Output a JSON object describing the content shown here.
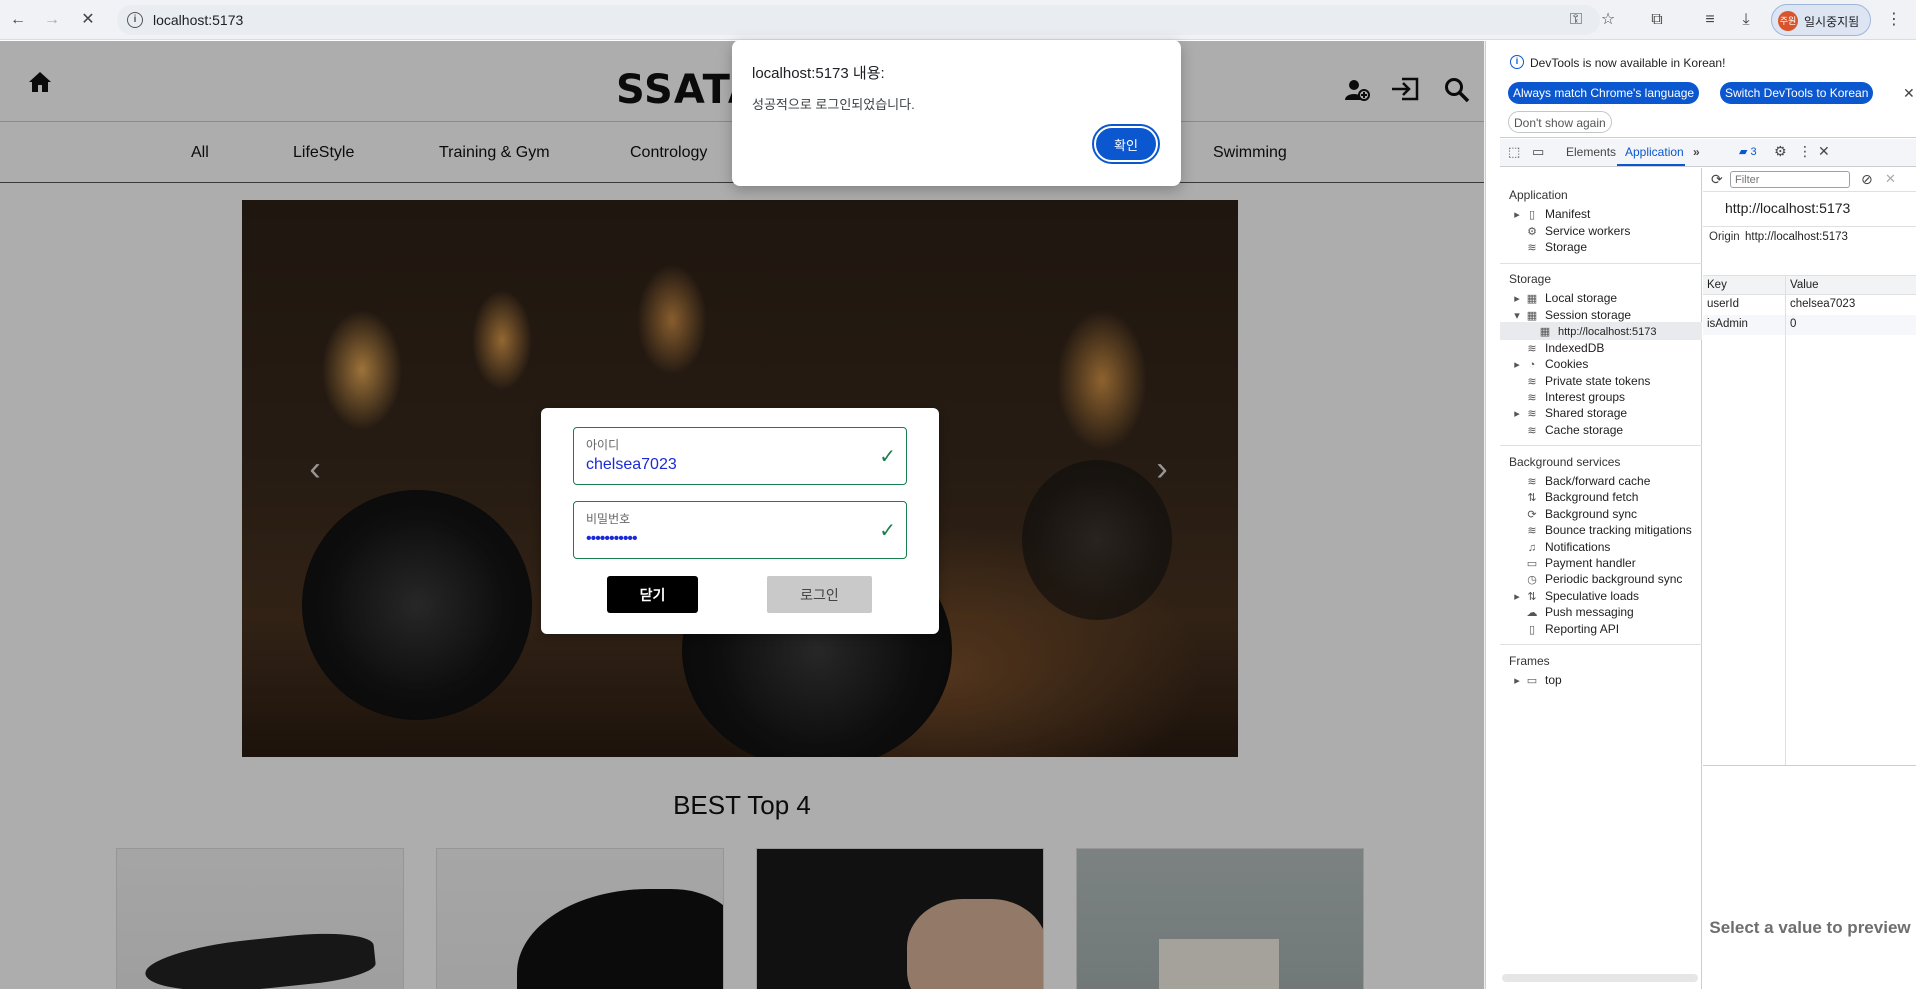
{
  "browser": {
    "url": "localhost:5173",
    "profile_label": "일시중지됨",
    "profile_avatar": "주원"
  },
  "site": {
    "logo": "SSATA",
    "categories": [
      "All",
      "LifeStyle",
      "Training & Gym",
      "Contrology",
      "Swimming"
    ],
    "best_title": "BEST Top 4",
    "carousel_prev": "‹",
    "carousel_next": "›"
  },
  "login_modal": {
    "id_label": "아이디",
    "id_value": "chelsea7023",
    "pw_label": "비밀번호",
    "pw_value": "•••••••••••",
    "close_label": "닫기",
    "login_label": "로그인"
  },
  "alert": {
    "title": "localhost:5173 내용:",
    "message": "성공적으로 로그인되었습니다.",
    "ok_label": "확인"
  },
  "devtools": {
    "banner": "DevTools is now available in Korean!",
    "btn_match": "Always match Chrome's language",
    "btn_switch": "Switch DevTools to Korean",
    "btn_dont_show": "Don't show again",
    "tabs": [
      "Elements",
      "Application"
    ],
    "issues_count": "3",
    "sidebar": {
      "application_heading": "Application",
      "application_items": [
        "Manifest",
        "Service workers",
        "Storage"
      ],
      "storage_heading": "Storage",
      "storage_items": [
        "Local storage",
        "Session storage",
        "http://localhost:5173",
        "IndexedDB",
        "Cookies",
        "Private state tokens",
        "Interest groups",
        "Shared storage",
        "Cache storage"
      ],
      "background_heading": "Background services",
      "background_items": [
        "Back/forward cache",
        "Background fetch",
        "Background sync",
        "Bounce tracking mitigations",
        "Notifications",
        "Payment handler",
        "Periodic background sync",
        "Speculative loads",
        "Push messaging",
        "Reporting API"
      ],
      "frames_heading": "Frames",
      "frames_items": [
        "top"
      ]
    },
    "filter_placeholder": "Filter",
    "origin_title": "http://localhost:5173",
    "origin_label": "Origin",
    "origin_value": "http://localhost:5173",
    "table": {
      "headers": [
        "Key",
        "Value"
      ],
      "rows": [
        {
          "key": "userId",
          "value": "chelsea7023"
        },
        {
          "key": "isAdmin",
          "value": "0"
        }
      ]
    },
    "preview_text": "Select a value to preview"
  }
}
